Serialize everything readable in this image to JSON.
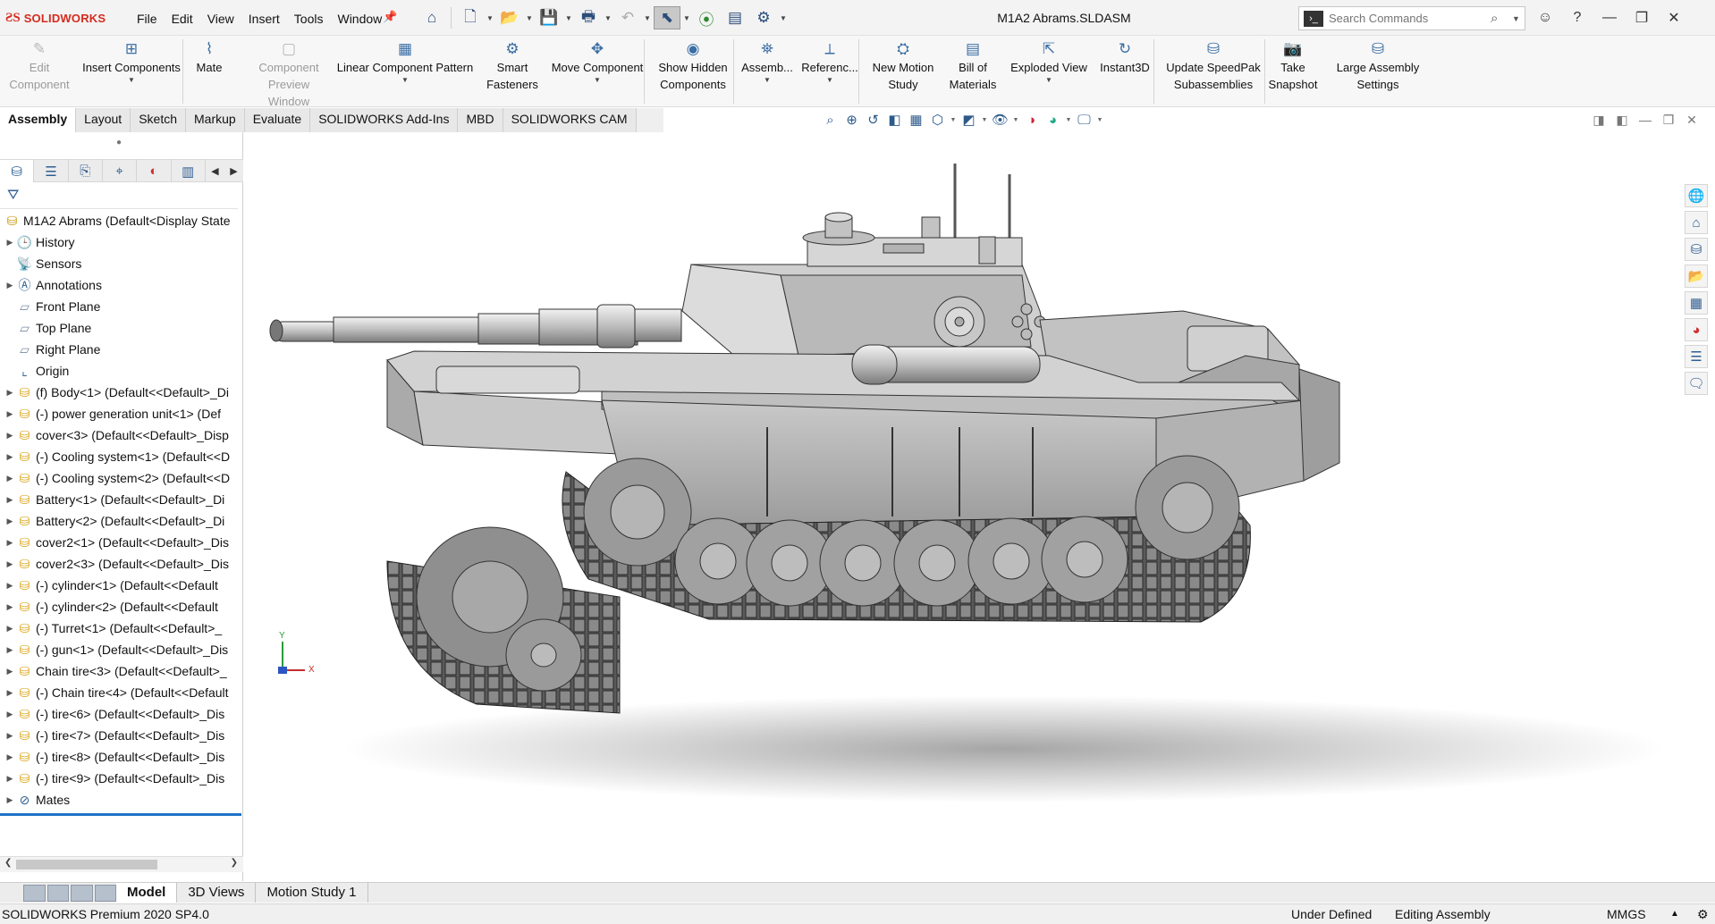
{
  "app": {
    "brand": "SOLIDWORKS",
    "doc_title": "M1A2 Abrams.SLDASM"
  },
  "menu": [
    "File",
    "Edit",
    "View",
    "Insert",
    "Tools",
    "Window"
  ],
  "search": {
    "placeholder": "Search Commands"
  },
  "commands": [
    {
      "label": "Edit\nComponent",
      "icon": "edit-component-icon",
      "disabled": true
    },
    {
      "label": "Insert Components",
      "icon": "insert-components-icon",
      "disabled": false
    },
    {
      "label": "Mate",
      "icon": "mate-icon",
      "disabled": false
    },
    {
      "label": "Component\nPreview Window",
      "icon": "component-preview-icon",
      "disabled": true
    },
    {
      "label": "Linear Component Pattern",
      "icon": "linear-pattern-icon",
      "disabled": false
    },
    {
      "label": "Smart\nFasteners",
      "icon": "smart-fasteners-icon",
      "disabled": false
    },
    {
      "label": "Move Component",
      "icon": "move-component-icon",
      "disabled": false
    },
    {
      "label": "Show Hidden\nComponents",
      "icon": "show-hidden-icon",
      "disabled": false
    },
    {
      "label": "Assemb...",
      "icon": "assembly-features-icon",
      "disabled": false
    },
    {
      "label": "Referenc...",
      "icon": "reference-geometry-icon",
      "disabled": false
    },
    {
      "label": "New Motion\nStudy",
      "icon": "motion-study-icon",
      "disabled": false
    },
    {
      "label": "Bill of\nMaterials",
      "icon": "bom-icon",
      "disabled": false
    },
    {
      "label": "Exploded View",
      "icon": "exploded-view-icon",
      "disabled": false
    },
    {
      "label": "Instant3D",
      "icon": "instant3d-icon",
      "disabled": false
    },
    {
      "label": "Update SpeedPak\nSubassemblies",
      "icon": "speedpak-icon",
      "disabled": false
    },
    {
      "label": "Take\nSnapshot",
      "icon": "snapshot-icon",
      "disabled": false
    },
    {
      "label": "Large Assembly\nSettings",
      "icon": "large-assembly-icon",
      "disabled": false
    }
  ],
  "tabs": [
    "Assembly",
    "Layout",
    "Sketch",
    "Markup",
    "Evaluate",
    "SOLIDWORKS Add-Ins",
    "MBD",
    "SOLIDWORKS CAM"
  ],
  "active_tab": "Assembly",
  "tree": {
    "root": "M1A2 Abrams  (Default<Display State",
    "items": [
      {
        "label": "History",
        "icon": "history",
        "expand": true
      },
      {
        "label": "Sensors",
        "icon": "sensors",
        "expand": false
      },
      {
        "label": "Annotations",
        "icon": "annotations",
        "expand": true
      },
      {
        "label": "Front Plane",
        "icon": "plane",
        "expand": false
      },
      {
        "label": "Top Plane",
        "icon": "plane",
        "expand": false
      },
      {
        "label": "Right Plane",
        "icon": "plane",
        "expand": false
      },
      {
        "label": "Origin",
        "icon": "origin",
        "expand": false
      },
      {
        "label": "(f) Body<1> (Default<<Default>_Di",
        "icon": "part",
        "expand": true
      },
      {
        "label": "(-) power generation unit<1> (Def",
        "icon": "part",
        "expand": true
      },
      {
        "label": "cover<3> (Default<<Default>_Disp",
        "icon": "part",
        "expand": true
      },
      {
        "label": "(-) Cooling system<1> (Default<<D",
        "icon": "part",
        "expand": true
      },
      {
        "label": "(-) Cooling system<2> (Default<<D",
        "icon": "part",
        "expand": true
      },
      {
        "label": "Battery<1> (Default<<Default>_Di",
        "icon": "part",
        "expand": true
      },
      {
        "label": "Battery<2> (Default<<Default>_Di",
        "icon": "part",
        "expand": true
      },
      {
        "label": "cover2<1> (Default<<Default>_Dis",
        "icon": "part",
        "expand": true
      },
      {
        "label": "cover2<3> (Default<<Default>_Dis",
        "icon": "part",
        "expand": true
      },
      {
        "label": "(-) cylinder<1> (Default<<Default",
        "icon": "part",
        "expand": true
      },
      {
        "label": "(-) cylinder<2> (Default<<Default",
        "icon": "part",
        "expand": true
      },
      {
        "label": "(-) Turret<1> (Default<<Default>_",
        "icon": "part",
        "expand": true
      },
      {
        "label": "(-) gun<1> (Default<<Default>_Dis",
        "icon": "part",
        "expand": true
      },
      {
        "label": "Chain tire<3> (Default<<Default>_",
        "icon": "part",
        "expand": true
      },
      {
        "label": "(-) Chain tire<4> (Default<<Default",
        "icon": "part",
        "expand": true
      },
      {
        "label": "(-) tire<6> (Default<<Default>_Dis",
        "icon": "part",
        "expand": true
      },
      {
        "label": "(-) tire<7> (Default<<Default>_Dis",
        "icon": "part",
        "expand": true
      },
      {
        "label": "(-) tire<8> (Default<<Default>_Dis",
        "icon": "part",
        "expand": true
      },
      {
        "label": "(-) tire<9> (Default<<Default>_Dis",
        "icon": "part",
        "expand": true
      },
      {
        "label": "Mates",
        "icon": "mates",
        "expand": true
      }
    ]
  },
  "triad": {
    "x": "X",
    "y": "Y"
  },
  "bottom_tabs": [
    "Model",
    "3D Views",
    "Motion Study 1"
  ],
  "active_bottom_tab": "Model",
  "status": {
    "product": "SOLIDWORKS Premium 2020 SP4.0",
    "state": "Under Defined",
    "mode": "Editing Assembly",
    "units": "MMGS"
  },
  "colors": {
    "brand_red": "#d52b1e",
    "accent_blue": "#1f73c9",
    "model_gray": "#b8b8b8"
  }
}
